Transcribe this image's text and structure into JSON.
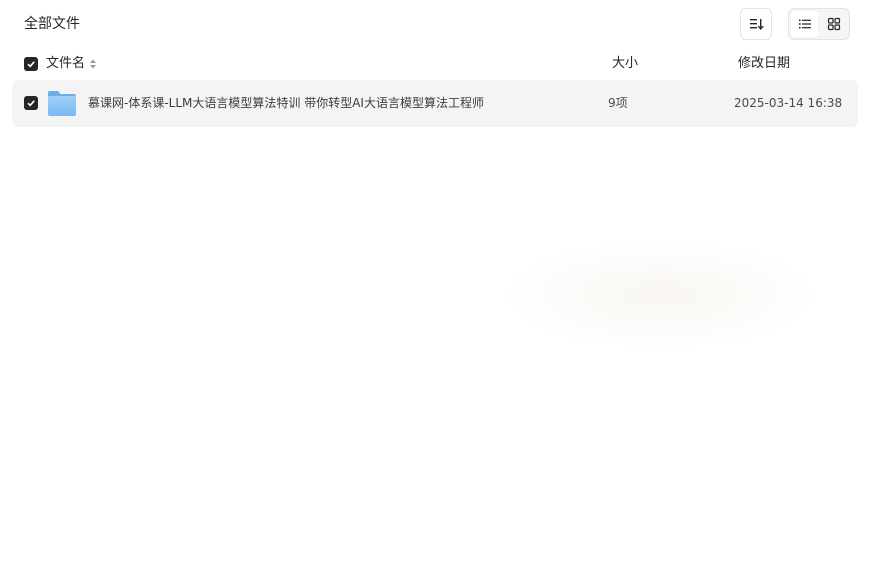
{
  "breadcrumb": {
    "root": "全部文件"
  },
  "toolbar": {
    "sort_icon": "sort-lines-icon",
    "list_view_icon": "list-view-icon",
    "grid_view_icon": "grid-view-icon"
  },
  "table": {
    "columns": {
      "name": "文件名",
      "size": "大小",
      "modified": "修改日期"
    },
    "rows": [
      {
        "name": "慕课网-体系课-LLM大语言模型算法特训 带你转型AI大语言模型算法工程师",
        "size": "9项",
        "modified": "2025-03-14 16:38",
        "icon": "folder-icon",
        "checked": true
      }
    ]
  },
  "colors": {
    "text": "#25262b",
    "row_bg": "#f4f4f5",
    "folder": "#8cc5f5",
    "checkbox": "#25262b"
  }
}
